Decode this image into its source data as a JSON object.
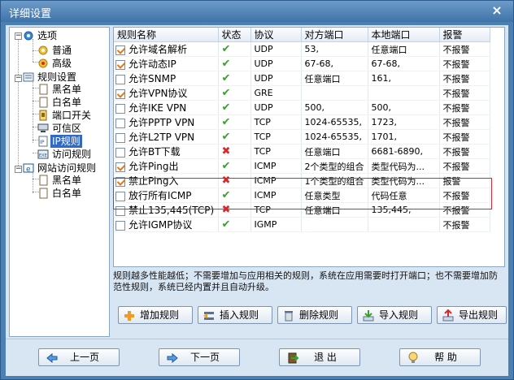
{
  "window": {
    "title": "详细设置",
    "close": "×"
  },
  "tree": {
    "root_options": "选项",
    "general": "普通",
    "advanced": "高级",
    "rules": "规则设置",
    "blacklist": "黑名单",
    "whitelist": "白名单",
    "port_switch": "端口开关",
    "trusted_zone": "可信区",
    "ip_rules": "IP规则",
    "access_rules": "访问规则",
    "web_rules": "网站访问规则",
    "web_blacklist": "黑名单",
    "web_whitelist": "白名单"
  },
  "table": {
    "columns": [
      "规则名称",
      "状态",
      "协议",
      "对方端口",
      "本地端口",
      "报警"
    ],
    "rows": [
      {
        "checked": true,
        "name": "允许域名解析",
        "status": "allow",
        "protocol": "UDP",
        "remote": "53,",
        "local": "任意端口",
        "alarm": "不报警"
      },
      {
        "checked": true,
        "name": "允许动态IP",
        "status": "allow",
        "protocol": "UDP",
        "remote": "67-68,",
        "local": "67-68,",
        "alarm": "不报警"
      },
      {
        "checked": false,
        "name": "允许SNMP",
        "status": "allow",
        "protocol": "UDP",
        "remote": "任意端口",
        "local": "161,",
        "alarm": "不报警"
      },
      {
        "checked": true,
        "name": "允许VPN协议",
        "status": "allow",
        "protocol": "GRE",
        "remote": "",
        "local": "",
        "alarm": "不报警"
      },
      {
        "checked": false,
        "name": "允许IKE VPN",
        "status": "allow",
        "protocol": "UDP",
        "remote": "500,",
        "local": "500,",
        "alarm": "不报警"
      },
      {
        "checked": false,
        "name": "允许PPTP VPN",
        "status": "allow",
        "protocol": "TCP",
        "remote": "1024-65535,",
        "local": "1723,",
        "alarm": "不报警"
      },
      {
        "checked": false,
        "name": "允许L2TP VPN",
        "status": "allow",
        "protocol": "TCP",
        "remote": "1024-65535,",
        "local": "1701,",
        "alarm": "不报警"
      },
      {
        "checked": false,
        "name": "允许BT下载",
        "status": "deny",
        "protocol": "TCP",
        "remote": "任意端口",
        "local": "6681-6890,",
        "alarm": "不报警"
      },
      {
        "checked": true,
        "name": "允许Ping出",
        "status": "allow",
        "protocol": "ICMP",
        "remote": "2个类型的组合",
        "local": "类型代码为...",
        "alarm": "不报警"
      },
      {
        "checked": true,
        "name": "禁止Ping入",
        "status": "deny",
        "protocol": "ICMP",
        "remote": "1个类型的组合",
        "local": "类型代码为...",
        "alarm": "报警"
      },
      {
        "checked": false,
        "name": "放行所有ICMP",
        "status": "allow",
        "protocol": "ICMP",
        "remote": "任意类型",
        "local": "代码任意",
        "alarm": "不报警"
      },
      {
        "checked": false,
        "name": "禁止135,445(TCP)",
        "status": "deny",
        "protocol": "TCP",
        "remote": "任意端口",
        "local": "135,445,",
        "alarm": "不报警"
      },
      {
        "checked": false,
        "name": "允许IGMP协议",
        "status": "allow",
        "protocol": "IGMP",
        "remote": "",
        "local": "",
        "alarm": "不报警"
      }
    ]
  },
  "description": "规则越多性能越低；不需要增加与应用相关的规则，系统在应用需要时打开端口；也不需要增加防范性规则，系统已经内置并且自动升级。",
  "rule_buttons": {
    "add": "增加规则",
    "insert": "插入规则",
    "delete": "删除规则",
    "import": "导入规则",
    "export": "导出规则"
  },
  "nav_buttons": {
    "prev": "上一页",
    "next": "下一页",
    "exit": "退 出",
    "help": "帮 助"
  },
  "icons": {
    "allow": "✔",
    "deny": "✖"
  },
  "colors": {
    "accent": "#316ac5",
    "allow": "#3aa02c",
    "deny": "#d8282a",
    "highlight": "#d8282a"
  }
}
